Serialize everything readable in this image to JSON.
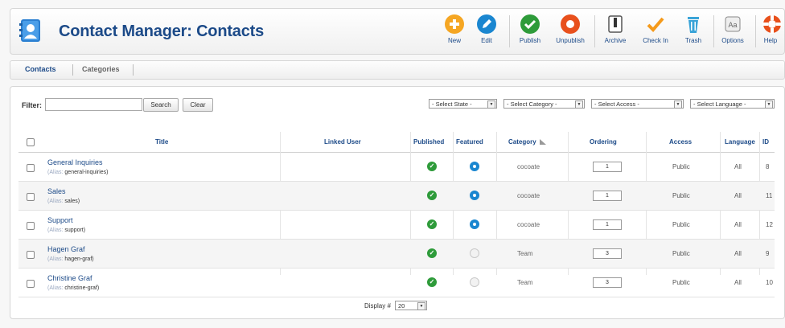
{
  "header": {
    "title": "Contact Manager: Contacts"
  },
  "toolbar": {
    "buttons": [
      {
        "label": "New",
        "icon": "plus-circle-icon",
        "color": "#f5a623"
      },
      {
        "label": "Edit",
        "icon": "pencil-circle-icon",
        "color": "#1a86d0"
      },
      {
        "label": "Publish",
        "icon": "check-circle-icon",
        "color": "#2e9b3a"
      },
      {
        "label": "Unpublish",
        "icon": "ring-circle-icon",
        "color": "#e8501c"
      },
      {
        "label": "Archive",
        "icon": "archive-box-icon",
        "color": "#555555"
      },
      {
        "label": "Check In",
        "icon": "checkmark-icon",
        "color": "#f59a1b"
      },
      {
        "label": "Trash",
        "icon": "trash-can-icon",
        "color": "#3aa4d8"
      },
      {
        "label": "Options",
        "icon": "options-icon",
        "color": "#888888"
      },
      {
        "label": "Help",
        "icon": "lifebuoy-icon",
        "color": "#e8501c"
      }
    ]
  },
  "tabs": [
    {
      "label": "Contacts",
      "active": true
    },
    {
      "label": "Categories",
      "active": false
    }
  ],
  "filter": {
    "label": "Filter:",
    "value": "",
    "search_label": "Search",
    "clear_label": "Clear"
  },
  "selects": {
    "state": "- Select State -",
    "category": "- Select Category -",
    "access": "- Select Access -",
    "language": "- Select Language -"
  },
  "table": {
    "headers": {
      "title": "Title",
      "linked_user": "Linked User",
      "published": "Published",
      "featured": "Featured",
      "category": "Category",
      "ordering": "Ordering",
      "access": "Access",
      "language": "Language",
      "id": "ID"
    },
    "alias_prefix": "(Alias:",
    "rows": [
      {
        "title": "General Inquiries",
        "alias": "general-inquiries)",
        "linked_user": "",
        "published": true,
        "featured": true,
        "category": "cocoate",
        "ordering": "1",
        "access": "Public",
        "language": "All",
        "id": "8"
      },
      {
        "title": "Sales",
        "alias": "sales)",
        "linked_user": "",
        "published": true,
        "featured": true,
        "category": "cocoate",
        "ordering": "1",
        "access": "Public",
        "language": "All",
        "id": "11"
      },
      {
        "title": "Support",
        "alias": "support)",
        "linked_user": "",
        "published": true,
        "featured": true,
        "category": "cocoate",
        "ordering": "1",
        "access": "Public",
        "language": "All",
        "id": "12"
      },
      {
        "title": "Hagen Graf",
        "alias": "hagen-graf)",
        "linked_user": "",
        "published": true,
        "featured": false,
        "category": "Team",
        "ordering": "3",
        "access": "Public",
        "language": "All",
        "id": "9"
      },
      {
        "title": "Christine Graf",
        "alias": "christine-graf)",
        "linked_user": "",
        "published": true,
        "featured": false,
        "category": "Team",
        "ordering": "3",
        "access": "Public",
        "language": "All",
        "id": "10"
      }
    ]
  },
  "footer": {
    "display_label": "Display #",
    "display_value": "20"
  }
}
